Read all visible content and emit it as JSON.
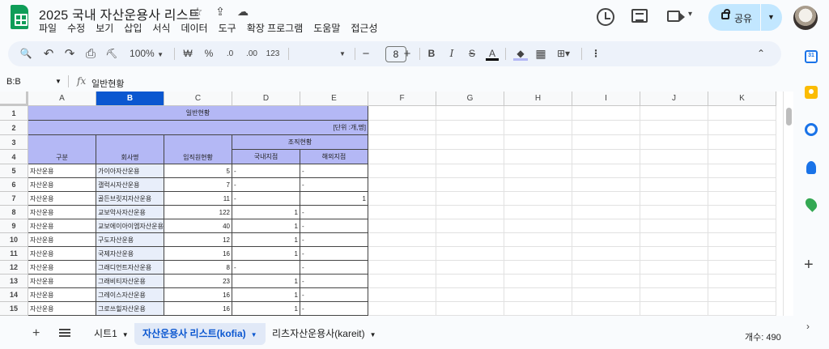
{
  "title": "2025 국내 자산운용사 리스트",
  "title_icons": [
    "☆",
    "⇪",
    "☁"
  ],
  "menu": [
    "파일",
    "수정",
    "보기",
    "삽입",
    "서식",
    "데이터",
    "도구",
    "확장 프로그램",
    "도움말",
    "접근성"
  ],
  "share_label": "공유",
  "toolbar": {
    "search": "🔍",
    "undo": "↶",
    "redo": "↷",
    "print": "⎙",
    "paint": "⛏",
    "zoom": "100%",
    "currency": "₩",
    "percent": "%",
    "dec_less": ".0",
    "dec_more": ".00",
    "num_fmt": "123",
    "font_size": "8",
    "minus": "−",
    "plus": "+",
    "bold": "B",
    "italic": "I",
    "strike": "S",
    "textcolor": "A",
    "more": "⋮",
    "collapse": "⌃"
  },
  "formula_bar": {
    "name_box": "B:B",
    "fx": "fx",
    "value": "일반현황"
  },
  "columns": [
    "A",
    "B",
    "C",
    "D",
    "E",
    "F",
    "G",
    "H",
    "I",
    "J",
    "K"
  ],
  "rows": [
    "1",
    "2",
    "3",
    "4",
    "5",
    "6",
    "7",
    "8",
    "9",
    "10",
    "11",
    "12",
    "13",
    "14",
    "15"
  ],
  "sheet_header": {
    "title": "일반현황",
    "unit": "[단위 :개,명]",
    "col_a": "구분",
    "col_b": "회사명",
    "col_c": "임직원현황",
    "org": "조직현황",
    "domestic": "국내지점",
    "overseas": "해외지점"
  },
  "data_rows": [
    {
      "a": "자산운용",
      "b": "가이아자산운용",
      "c": "5",
      "d": "-",
      "e": "-"
    },
    {
      "a": "자산운용",
      "b": "갤럭시자산운용",
      "c": "7",
      "d": "-",
      "e": "-"
    },
    {
      "a": "자산운용",
      "b": "골든브릿지자산운용",
      "c": "11",
      "d": "-",
      "e": "1"
    },
    {
      "a": "자산운용",
      "b": "교보악사자산운용",
      "c": "122",
      "d": "1",
      "e": "-"
    },
    {
      "a": "자산운용",
      "b": "교보에이아이엠자산운용",
      "c": "40",
      "d": "1",
      "e": "-"
    },
    {
      "a": "자산운용",
      "b": "구도자산운용",
      "c": "12",
      "d": "1",
      "e": "-"
    },
    {
      "a": "자산운용",
      "b": "국제자산운용",
      "c": "16",
      "d": "1",
      "e": "-"
    },
    {
      "a": "자산운용",
      "b": "그래디언트자산운용",
      "c": "8",
      "d": "-",
      "e": "-"
    },
    {
      "a": "자산운용",
      "b": "그래비티자산운용",
      "c": "23",
      "d": "1",
      "e": "-"
    },
    {
      "a": "자산운용",
      "b": "그레이스자산운용",
      "c": "16",
      "d": "1",
      "e": "-"
    },
    {
      "a": "자산운용",
      "b": "그로쓰힐자산운용",
      "c": "16",
      "d": "1",
      "e": "-"
    }
  ],
  "sheet_tabs": [
    {
      "label": "시트1",
      "active": false
    },
    {
      "label": "자산운용사 리스트(kofia)",
      "active": true
    },
    {
      "label": "리츠자산운용사(kareit)",
      "active": false
    }
  ],
  "count_label": "개수: 490",
  "colors": {
    "accent": "#0b57d0",
    "header_fill": "#b4b8f5",
    "share": "#c2e7ff"
  }
}
